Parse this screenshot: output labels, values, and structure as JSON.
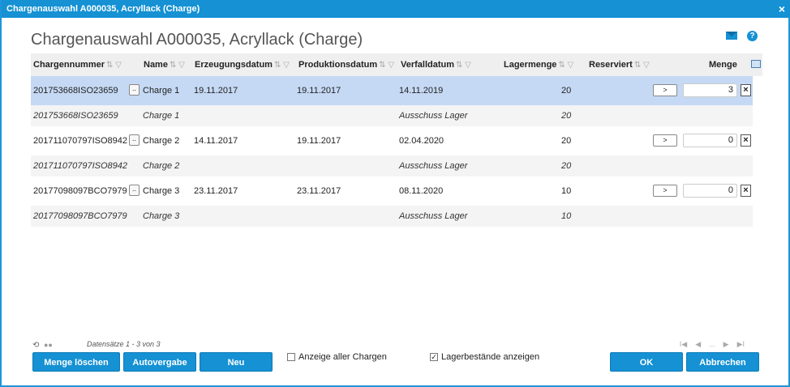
{
  "window": {
    "title": "Chargenauswahl A000035, Acryllack (Charge)",
    "close_label": "×"
  },
  "page_title": "Chargenauswahl A000035, Acryllack (Charge)",
  "columns": {
    "chargennummer": "Chargennummer",
    "name": "Name",
    "erzeugungsdatum": "Erzeugungsdatum",
    "produktionsdatum": "Produktionsdatum",
    "verfalldatum": "Verfalldatum",
    "lagermenge": "Lagermenge",
    "reserviert": "Reserviert",
    "menge": "Menge"
  },
  "rows": [
    {
      "nummer": "201753668ISO23659",
      "name": "Charge 1",
      "erzeugung": "19.11.2017",
      "produktion": "19.11.2017",
      "verfall": "14.11.2019",
      "lagermenge": "20",
      "menge": "3",
      "sub": {
        "nummer": "201753668ISO23659",
        "name": "Charge 1",
        "lager": "Ausschuss Lager",
        "lagermenge": "20"
      }
    },
    {
      "nummer": "201711070797ISO8942",
      "name": "Charge 2",
      "erzeugung": "14.11.2017",
      "produktion": "19.11.2017",
      "verfall": "02.04.2020",
      "lagermenge": "20",
      "menge": "0",
      "sub": {
        "nummer": "201711070797ISO8942",
        "name": "Charge 2",
        "lager": "Ausschuss Lager",
        "lagermenge": "20"
      }
    },
    {
      "nummer": "20177098097BCO7979",
      "name": "Charge 3",
      "erzeugung": "23.11.2017",
      "produktion": "23.11.2017",
      "verfall": "08.11.2020",
      "lagermenge": "10",
      "menge": "0",
      "sub": {
        "nummer": "20177098097BCO7979",
        "name": "Charge 3",
        "lager": "Ausschuss Lager",
        "lagermenge": "10"
      }
    }
  ],
  "row_buttons": {
    "dots": "..",
    "arrow": ">",
    "clear": "×"
  },
  "footer": {
    "records": "Datensätze 1 - 3 von 3",
    "pager": [
      "I◀",
      "◀",
      "...",
      "▶",
      "▶I"
    ]
  },
  "buttons": {
    "menge_loeschen": "Menge löschen",
    "autovergabe": "Autovergabe",
    "neu": "Neu",
    "ok": "OK",
    "abbrechen": "Abbrechen"
  },
  "checkboxes": {
    "alle_chargen": {
      "label": "Anzeige aller Chargen",
      "checked": false
    },
    "lagerbestaende": {
      "label": "Lagerbestände anzeigen",
      "checked": true
    }
  },
  "colors": {
    "accent": "#1591d4",
    "selected_row": "#c5d9f4",
    "sub_row": "#f4f4f4"
  }
}
